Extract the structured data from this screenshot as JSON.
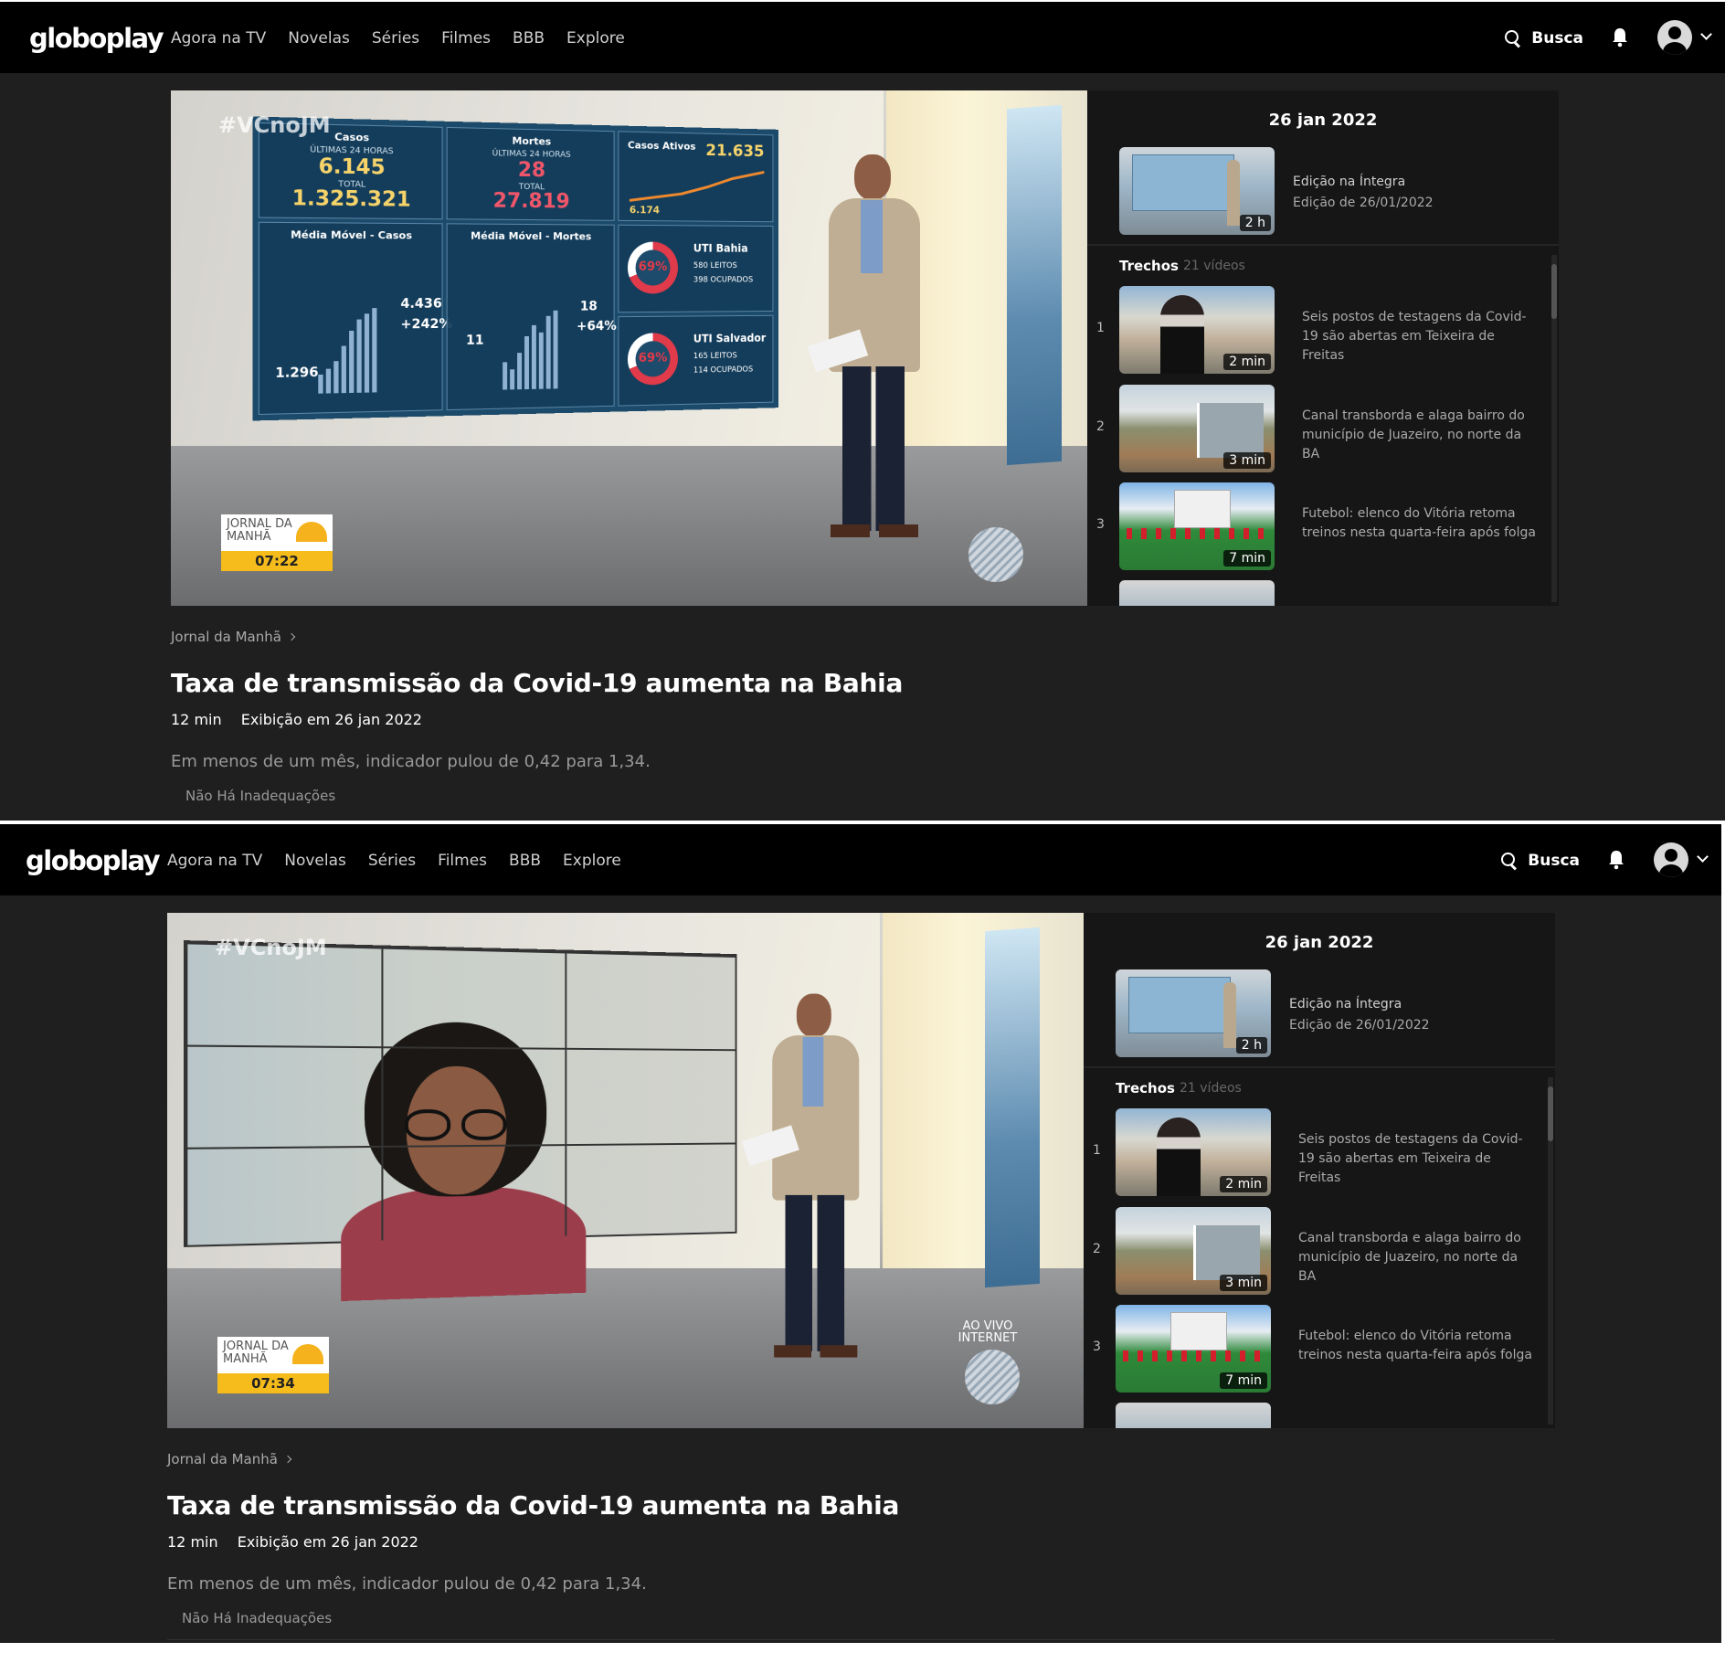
{
  "screenshots": [
    {
      "nav": {
        "logo": "globoplay",
        "items": [
          "Agora na TV",
          "Novelas",
          "Séries",
          "Filmes",
          "BBB",
          "Explore"
        ],
        "search_label": "Busca"
      },
      "player": {
        "hashtag": "#VCnoJM",
        "logo_text": "JORNAL DA MANHÃ",
        "time": "07:22",
        "live_text": "",
        "dashboard": {
          "casos_title": "Casos",
          "casos_24h_label": "ÚLTIMAS 24 HORAS",
          "casos_24h": "6.145",
          "casos_total_label": "TOTAL",
          "casos_total": "1.325.321",
          "mortes_title": "Mortes",
          "mortes_24h_label": "ÚLTIMAS 24 HORAS",
          "mortes_24h": "28",
          "mortes_total_label": "TOTAL",
          "mortes_total": "27.819",
          "ativos_title": "Casos Ativos",
          "ativos_value": "21.635",
          "ativos_start": "6.174",
          "movel_casos_title": "Média Móvel - Casos",
          "movel_casos_start": "1.296",
          "movel_casos_end": "4.436",
          "movel_casos_pct": "+242%",
          "movel_mortes_title": "Média Móvel - Mortes",
          "movel_mortes_start": "11",
          "movel_mortes_end": "18",
          "movel_mortes_pct": "+64%",
          "uti_bahia_title": "UTI Bahia",
          "uti_bahia_pct": "69%",
          "uti_bahia_leitos": "580 LEITOS",
          "uti_bahia_ocupados": "398 OCUPADOS",
          "uti_ssa_title": "UTI Salvador",
          "uti_ssa_pct": "69%",
          "uti_ssa_leitos": "165 LEITOS",
          "uti_ssa_ocupados": "114 OCUPADOS"
        }
      },
      "panel": {
        "date": "26 jan 2022",
        "full_episode": {
          "title": "Edição na Íntegra",
          "subtitle": "Edição de 26/01/2022",
          "duration": "2 h"
        },
        "trechos_label": "Trechos",
        "trechos_count": "21 vídeos",
        "clips": [
          {
            "num": "1",
            "title": "Seis postos de testagens da Covid-19 são abertas em Teixeira de Freitas",
            "duration": "2 min"
          },
          {
            "num": "2",
            "title": "Canal transborda e alaga bairro do município de Juazeiro, no norte da BA",
            "duration": "3 min"
          },
          {
            "num": "3",
            "title": "Futebol: elenco do Vitória retoma treinos nesta quarta-feira após folga",
            "duration": "7 min"
          }
        ]
      },
      "info": {
        "breadcrumb": "Jornal da Manhã",
        "title": "Taxa de transmissão da Covid-19 aumenta na Bahia",
        "duration": "12 min",
        "aired": "Exibição em 26 jan 2022",
        "description": "Em menos de um mês, indicador pulou de 0,42 para 1,34.",
        "rating": "Não Há Inadequações"
      }
    },
    {
      "nav": {
        "logo": "globoplay",
        "items": [
          "Agora na TV",
          "Novelas",
          "Séries",
          "Filmes",
          "BBB",
          "Explore"
        ],
        "search_label": "Busca"
      },
      "player": {
        "hashtag": "#VCnoJM",
        "logo_text": "JORNAL DA MANHÃ",
        "time": "07:34",
        "live_text": "AO VIVO INTERNET"
      },
      "panel": {
        "date": "26 jan 2022",
        "full_episode": {
          "title": "Edição na Íntegra",
          "subtitle": "Edição de 26/01/2022",
          "duration": "2 h"
        },
        "trechos_label": "Trechos",
        "trechos_count": "21 vídeos",
        "clips": [
          {
            "num": "1",
            "title": "Seis postos de testagens da Covid-19 são abertas em Teixeira de Freitas",
            "duration": "2 min"
          },
          {
            "num": "2",
            "title": "Canal transborda e alaga bairro do município de Juazeiro, no norte da BA",
            "duration": "3 min"
          },
          {
            "num": "3",
            "title": "Futebol: elenco do Vitória retoma treinos nesta quarta-feira após folga",
            "duration": "7 min"
          }
        ]
      },
      "info": {
        "breadcrumb": "Jornal da Manhã",
        "title": "Taxa de transmissão da Covid-19 aumenta na Bahia",
        "duration": "12 min",
        "aired": "Exibição em 26 jan 2022",
        "description": "Em menos de um mês, indicador pulou de 0,42 para 1,34.",
        "rating": "Não Há Inadequações"
      }
    }
  ]
}
